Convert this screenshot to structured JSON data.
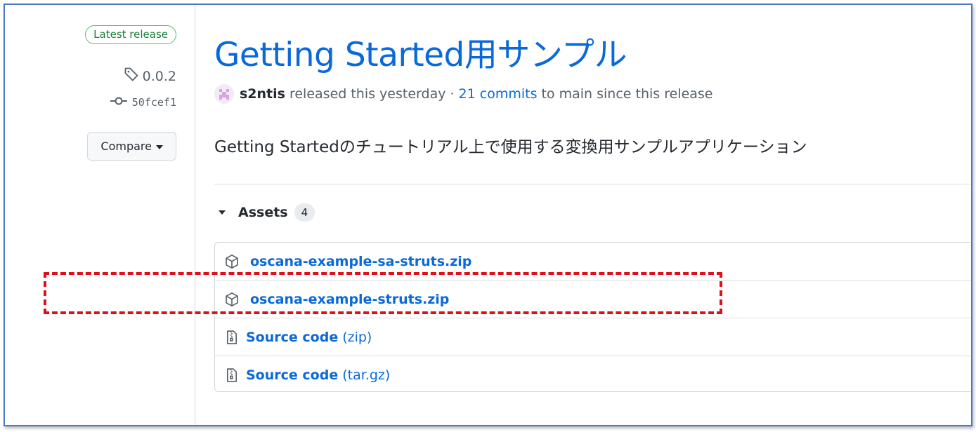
{
  "sidebar": {
    "latest_badge": "Latest release",
    "tag": "0.0.2",
    "commit": "50fcef1",
    "compare_label": "Compare"
  },
  "release": {
    "title": "Getting Started用サンプル",
    "author": "s2ntis",
    "released_text": "released this yesterday ·",
    "commits_link": "21 commits",
    "since_text": "to main since this release",
    "description": "Getting Startedのチュートリアル上で使用する変換用サンプルアプリケーション"
  },
  "assets": {
    "label": "Assets",
    "count": "4",
    "items": [
      {
        "name": "oscana-example-sa-struts.zip",
        "suffix": "",
        "icon": "package-icon"
      },
      {
        "name": "oscana-example-struts.zip",
        "suffix": "",
        "icon": "package-icon"
      },
      {
        "name": "Source code",
        "suffix": "(zip)",
        "icon": "file-zip-icon"
      },
      {
        "name": "Source code",
        "suffix": "(tar.gz)",
        "icon": "file-zip-icon"
      }
    ]
  },
  "colors": {
    "link": "#0969da",
    "badge_green": "#1a7f37",
    "highlight": "#e0101a",
    "frame": "#4a78c8"
  }
}
